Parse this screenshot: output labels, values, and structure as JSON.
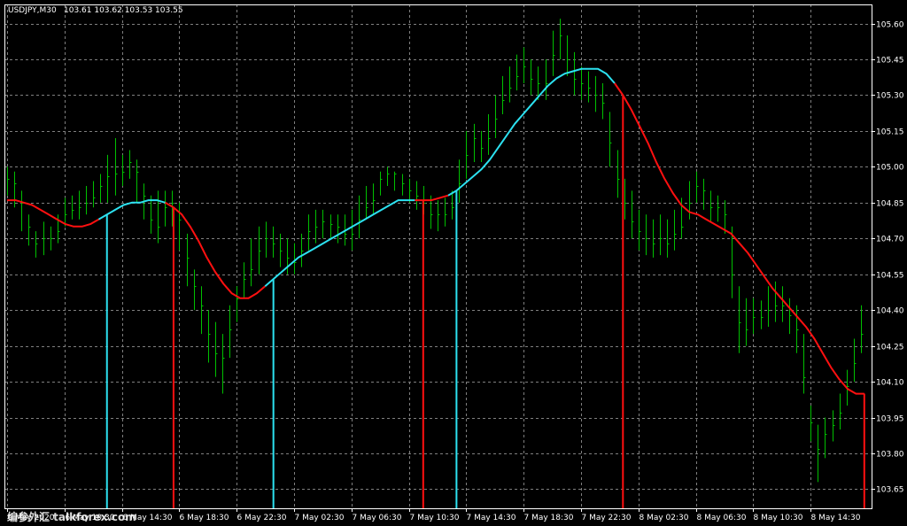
{
  "header": {
    "symbol_label": "USDJPY,M30",
    "ohlc_label": "103.61 103.62 103.53 103.55"
  },
  "watermark": {
    "text": "编参外汇 talkforex.com"
  },
  "colors": {
    "background": "#000000",
    "grid": "#7f7f7f",
    "bars": "#00c000",
    "rising": "#2ce1f0",
    "falling": "#ff1010",
    "text": "#ffffff"
  },
  "chart_data": {
    "type": "line",
    "symbol": "USDJPY",
    "timeframe": "M30",
    "ylim": [
      103.57,
      105.68
    ],
    "y_ticks": [
      "105.60",
      "105.45",
      "105.30",
      "105.15",
      "105.00",
      "104.85",
      "104.70",
      "104.55",
      "104.40",
      "104.25",
      "104.10",
      "103.95",
      "103.80",
      "103.65"
    ],
    "x_tick_labels": [
      "6 May 2020",
      "6 May 10:30",
      "6 May 14:30",
      "6 May 18:30",
      "6 May 22:30",
      "7 May 02:30",
      "7 May 06:30",
      "7 May 10:30",
      "7 May 14:30",
      "7 May 18:30",
      "7 May 22:30",
      "8 May 02:30",
      "8 May 06:30",
      "8 May 10:30",
      "8 May 14:30"
    ],
    "bars_per_tick": 8,
    "bar_count": 120,
    "price_bars": {
      "closes": [
        104.95,
        104.93,
        104.85,
        104.75,
        104.68,
        104.7,
        104.7,
        104.73,
        104.8,
        104.82,
        104.83,
        104.85,
        104.87,
        104.92,
        104.96,
        104.97,
        104.98,
        105.02,
        104.98,
        104.88,
        104.78,
        104.75,
        104.83,
        104.85,
        104.78,
        104.62,
        104.5,
        104.42,
        104.3,
        104.22,
        104.2,
        104.32,
        104.45,
        104.53,
        104.57,
        104.65,
        104.7,
        104.68,
        104.65,
        104.62,
        104.6,
        104.65,
        104.73,
        104.75,
        104.77,
        104.76,
        104.75,
        104.72,
        104.72,
        104.78,
        104.83,
        104.86,
        104.95,
        104.97,
        104.97,
        104.93,
        104.9,
        104.88,
        104.85,
        104.8,
        104.8,
        104.8,
        104.83,
        104.93,
        105.05,
        105.12,
        105.08,
        105.12,
        105.2,
        105.28,
        105.33,
        105.38,
        105.42,
        105.37,
        105.35,
        105.35,
        105.47,
        105.55,
        105.45,
        105.37,
        105.35,
        105.33,
        105.3,
        105.27,
        105.1,
        104.95,
        104.85,
        104.77,
        104.73,
        104.7,
        104.68,
        104.7,
        104.68,
        104.72,
        104.75,
        104.85,
        104.92,
        104.9,
        104.83,
        104.83,
        104.8,
        104.55,
        104.35,
        104.32,
        104.37,
        104.37,
        104.4,
        104.42,
        104.42,
        104.38,
        104.32,
        104.12,
        103.93,
        103.82,
        103.88,
        103.92,
        103.97,
        104.08,
        104.18,
        104.3
      ],
      "highs": [
        105.0,
        104.98,
        104.9,
        104.8,
        104.73,
        104.77,
        104.75,
        104.8,
        104.87,
        104.88,
        104.9,
        104.92,
        104.94,
        104.97,
        105.05,
        105.12,
        105.05,
        105.07,
        105.03,
        104.93,
        104.88,
        104.9,
        104.9,
        104.9,
        104.85,
        104.72,
        104.57,
        104.5,
        104.4,
        104.35,
        104.3,
        104.42,
        104.5,
        104.6,
        104.7,
        104.75,
        104.77,
        104.75,
        104.72,
        104.7,
        104.68,
        104.72,
        104.8,
        104.82,
        104.82,
        104.8,
        104.8,
        104.8,
        104.82,
        104.88,
        104.92,
        104.93,
        104.98,
        105.0,
        104.98,
        104.97,
        104.95,
        104.94,
        104.92,
        104.88,
        104.86,
        104.87,
        104.9,
        105.03,
        105.15,
        105.18,
        105.15,
        105.22,
        105.3,
        105.38,
        105.42,
        105.47,
        105.5,
        105.45,
        105.42,
        105.45,
        105.57,
        105.62,
        105.55,
        105.48,
        105.42,
        105.4,
        105.38,
        105.35,
        105.23,
        105.07,
        104.95,
        104.9,
        104.82,
        104.8,
        104.78,
        104.8,
        104.78,
        104.82,
        104.87,
        104.94,
        104.98,
        104.95,
        104.9,
        104.88,
        104.86,
        104.75,
        104.5,
        104.45,
        104.45,
        104.44,
        104.5,
        104.52,
        104.5,
        104.45,
        104.42,
        104.3,
        104.0,
        103.92,
        103.95,
        103.98,
        104.05,
        104.15,
        104.28,
        104.42
      ],
      "lows": [
        104.88,
        104.83,
        104.73,
        104.67,
        104.62,
        104.63,
        104.65,
        104.68,
        104.75,
        104.78,
        104.78,
        104.8,
        104.83,
        104.85,
        104.85,
        104.88,
        104.92,
        104.95,
        104.85,
        104.78,
        104.72,
        104.68,
        104.75,
        104.75,
        104.65,
        104.5,
        104.4,
        104.3,
        104.18,
        104.12,
        104.05,
        104.2,
        104.35,
        104.45,
        104.5,
        104.55,
        104.62,
        104.62,
        104.58,
        104.55,
        104.55,
        104.58,
        104.65,
        104.68,
        104.7,
        104.7,
        104.68,
        104.67,
        104.65,
        104.7,
        104.78,
        104.8,
        104.88,
        104.92,
        104.9,
        104.88,
        104.85,
        104.82,
        104.8,
        104.74,
        104.73,
        104.75,
        104.78,
        104.85,
        104.95,
        105.02,
        105.02,
        105.05,
        105.12,
        105.22,
        105.27,
        105.32,
        105.35,
        105.3,
        105.28,
        105.28,
        105.38,
        105.45,
        105.38,
        105.3,
        105.28,
        105.27,
        105.23,
        105.2,
        105.0,
        104.87,
        104.78,
        104.7,
        104.65,
        104.63,
        104.62,
        104.63,
        104.62,
        104.65,
        104.7,
        104.78,
        104.85,
        104.82,
        104.77,
        104.77,
        104.72,
        104.45,
        104.22,
        104.25,
        104.3,
        104.32,
        104.33,
        104.35,
        104.35,
        104.3,
        104.22,
        104.05,
        103.85,
        103.68,
        103.78,
        103.85,
        103.9,
        104.0,
        104.1,
        104.22
      ]
    },
    "indicator_line": {
      "values": [
        104.86,
        104.86,
        104.85,
        104.84,
        104.82,
        104.8,
        104.78,
        104.76,
        104.75,
        104.75,
        104.76,
        104.78,
        104.8,
        104.82,
        104.84,
        104.85,
        104.85,
        104.86,
        104.86,
        104.85,
        104.83,
        104.8,
        104.75,
        104.69,
        104.62,
        104.56,
        104.51,
        104.47,
        104.45,
        104.45,
        104.47,
        104.5,
        104.53,
        104.56,
        104.59,
        104.62,
        104.64,
        104.66,
        104.68,
        104.7,
        104.72,
        104.74,
        104.76,
        104.78,
        104.8,
        104.82,
        104.84,
        104.86,
        104.86,
        104.86,
        104.86,
        104.86,
        104.87,
        104.88,
        104.9,
        104.93,
        104.96,
        104.99,
        105.03,
        105.08,
        105.13,
        105.18,
        105.22,
        105.26,
        105.3,
        105.34,
        105.37,
        105.39,
        105.4,
        105.41,
        105.41,
        105.41,
        105.39,
        105.35,
        105.3,
        105.24,
        105.17,
        105.1,
        105.02,
        104.95,
        104.89,
        104.84,
        104.81,
        104.8,
        104.78,
        104.76,
        104.74,
        104.72,
        104.68,
        104.64,
        104.59,
        104.54,
        104.49,
        104.45,
        104.41,
        104.37,
        104.33,
        104.28,
        104.22,
        104.16,
        104.11,
        104.07,
        104.05,
        104.05
      ],
      "direction": [
        "falling",
        "falling",
        "falling",
        "falling",
        "falling",
        "falling",
        "falling",
        "falling",
        "falling",
        "falling",
        "falling",
        "rising",
        "rising",
        "rising",
        "rising",
        "rising",
        "rising",
        "rising",
        "rising",
        "falling",
        "falling",
        "falling",
        "falling",
        "falling",
        "falling",
        "falling",
        "falling",
        "falling",
        "falling",
        "falling",
        "falling",
        "rising",
        "rising",
        "rising",
        "rising",
        "rising",
        "rising",
        "rising",
        "rising",
        "rising",
        "rising",
        "rising",
        "rising",
        "rising",
        "rising",
        "rising",
        "rising",
        "rising",
        "rising",
        "falling",
        "falling",
        "falling",
        "falling",
        "rising",
        "rising",
        "rising",
        "rising",
        "rising",
        "rising",
        "rising",
        "rising",
        "rising",
        "rising",
        "rising",
        "rising",
        "rising",
        "rising",
        "rising",
        "rising",
        "rising",
        "rising",
        "rising",
        "rising",
        "falling",
        "falling",
        "falling",
        "falling",
        "falling",
        "falling",
        "falling",
        "falling",
        "falling",
        "falling",
        "falling",
        "falling",
        "falling",
        "falling",
        "falling",
        "falling",
        "falling",
        "falling",
        "falling",
        "falling",
        "falling",
        "falling",
        "falling",
        "falling",
        "falling",
        "falling",
        "falling",
        "falling",
        "falling",
        "falling",
        "falling"
      ]
    },
    "reversal_markers": [
      {
        "bar": 12,
        "color": "rising",
        "bottom": 103.57
      },
      {
        "bar": 20,
        "color": "falling",
        "bottom": 103.57
      },
      {
        "bar": 32,
        "color": "rising",
        "bottom": 103.57
      },
      {
        "bar": 50,
        "color": "falling",
        "bottom": 103.57
      },
      {
        "bar": 54,
        "color": "rising",
        "bottom": 103.57
      },
      {
        "bar": 74,
        "color": "falling",
        "bottom": 103.57
      }
    ],
    "last_price_marker": {
      "value": 104.05
    }
  }
}
